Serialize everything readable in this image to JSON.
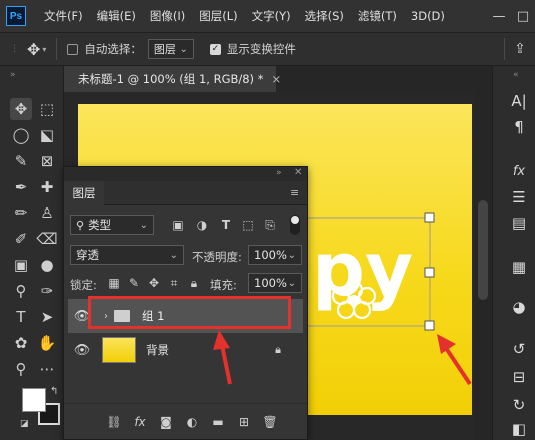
{
  "app": {
    "logo": "Ps"
  },
  "menu": [
    "文件(F)",
    "编辑(E)",
    "图像(I)",
    "图层(L)",
    "文字(Y)",
    "选择(S)",
    "滤镜(T)",
    "3D(D)"
  ],
  "window_controls": [
    "—",
    "□"
  ],
  "options": {
    "auto_select_label": "自动选择：",
    "auto_select_value": "图层",
    "show_transform_label": "显示变换控件"
  },
  "document_tab": {
    "title": "未标题-1 @ 100% (组 1, RGB/8) *",
    "close": "×"
  },
  "canvas_text": "py",
  "layers_panel": {
    "tab": "图层",
    "filter_kind": "类型",
    "blend_mode": "穿透",
    "opacity_label": "不透明度:",
    "opacity_value": "100%",
    "lock_label": "锁定:",
    "fill_label": "填充:",
    "fill_value": "100%",
    "layers": [
      {
        "name": "组 1",
        "type": "group",
        "selected": true
      },
      {
        "name": "背景",
        "type": "background",
        "locked": true
      }
    ]
  },
  "colors": {
    "annotation": "#e5312c",
    "canvas_top": "#fbe55a",
    "canvas_bottom": "#f2cf07",
    "selection_row": "#535353"
  }
}
